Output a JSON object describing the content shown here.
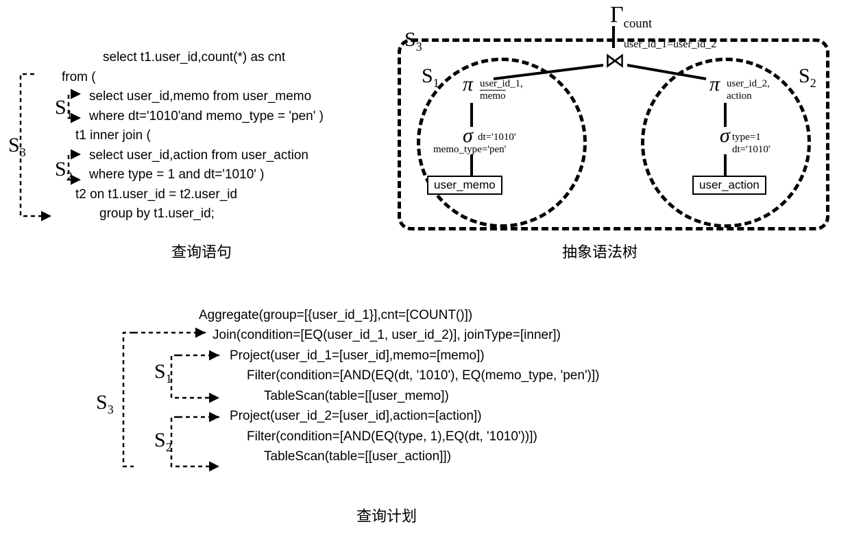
{
  "sql": {
    "l1": "select t1.user_id,count(*) as cnt",
    "l2": "from (",
    "l3": "select user_id,memo from user_memo",
    "l4": "where dt='1010'and memo_type = 'pen' )",
    "l5": "t1 inner join (",
    "l6": "select user_id,action from user_action",
    "l7": "where type = 1 and dt='1010' )",
    "l8": "t2 on t1.user_id = t2.user_id",
    "l9": "group by t1.user_id;"
  },
  "captions": {
    "query": "查询语句",
    "ast": "抽象语法树",
    "plan": "查询计划"
  },
  "labels": {
    "s1": "S",
    "s1sub": "1",
    "s2": "S",
    "s2sub": "2",
    "s3": "S",
    "s3sub": "3"
  },
  "ast": {
    "gamma": "Γ",
    "gamma_sub": "count",
    "join": "⋈",
    "join_sub": "user_id_1=user_id_2",
    "pi1": "π",
    "pi1_sub1": "user_id_1,",
    "pi1_sub2": "memo",
    "sigma1": "σ",
    "sigma1_sub1": "dt='1010'",
    "sigma1_sub2": "memo_type='pen'",
    "table1": "user_memo",
    "pi2": "π",
    "pi2_sub1": "user_id_2,",
    "pi2_sub2": "action",
    "sigma2": "σ",
    "sigma2_sub1": "type=1",
    "sigma2_sub2": "dt='1010'",
    "table2": "user_action"
  },
  "plan": {
    "l1": "Aggregate(group=[{user_id_1}],cnt=[COUNT()])",
    "l2": "Join(condition=[EQ(user_id_1, user_id_2)], joinType=[inner])",
    "l3": "Project(user_id_1=[user_id],memo=[memo])",
    "l4": "Filter(condition=[AND(EQ(dt, '1010'), EQ(memo_type, 'pen')])",
    "l5": "TableScan(table=[[user_memo])",
    "l6": "Project(user_id_2=[user_id],action=[action])",
    "l7": "Filter(condition=[AND(EQ(type, 1),EQ(dt, '1010'))])",
    "l8": "TableScan(table=[[user_action]])"
  }
}
